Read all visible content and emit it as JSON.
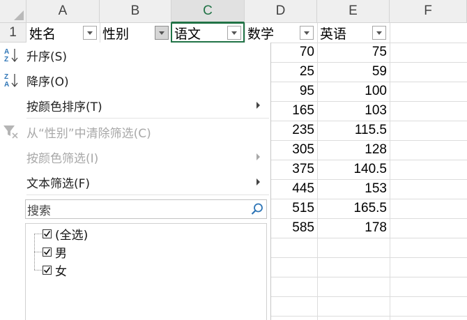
{
  "column_headers": [
    "A",
    "B",
    "C",
    "D",
    "E",
    "F"
  ],
  "selected_column": "C",
  "row_numbers": [
    "1"
  ],
  "header_row": [
    {
      "text": "姓名",
      "filter_active": false
    },
    {
      "text": "性别",
      "filter_active": true
    },
    {
      "text": "语文",
      "filter_active": false
    },
    {
      "text": "数学",
      "filter_active": false
    },
    {
      "text": "英语",
      "filter_active": false
    }
  ],
  "column_d_values": [
    "70",
    "25",
    "95",
    "165",
    "235",
    "305",
    "375",
    "445",
    "515",
    "585"
  ],
  "column_e_values": [
    "75",
    "59",
    "100",
    "103",
    "115.5",
    "128",
    "140.5",
    "153",
    "165.5",
    "178"
  ],
  "filter_menu": {
    "sort_ascending": "升序(S)",
    "sort_descending": "降序(O)",
    "sort_by_color": "按颜色排序(T)",
    "clear_filter": "从“性别”中清除筛选(C)",
    "filter_by_color": "按颜色筛选(I)",
    "text_filters": "文本筛选(F)",
    "search_placeholder": "搜索",
    "list_items": [
      {
        "label": "(全选)",
        "checked": true
      },
      {
        "label": "男",
        "checked": true
      },
      {
        "label": "女",
        "checked": true
      }
    ]
  },
  "colors": {
    "accent_green": "#217346",
    "sort_icon_blue": "#2e75b6",
    "header_bg": "#efefef"
  }
}
